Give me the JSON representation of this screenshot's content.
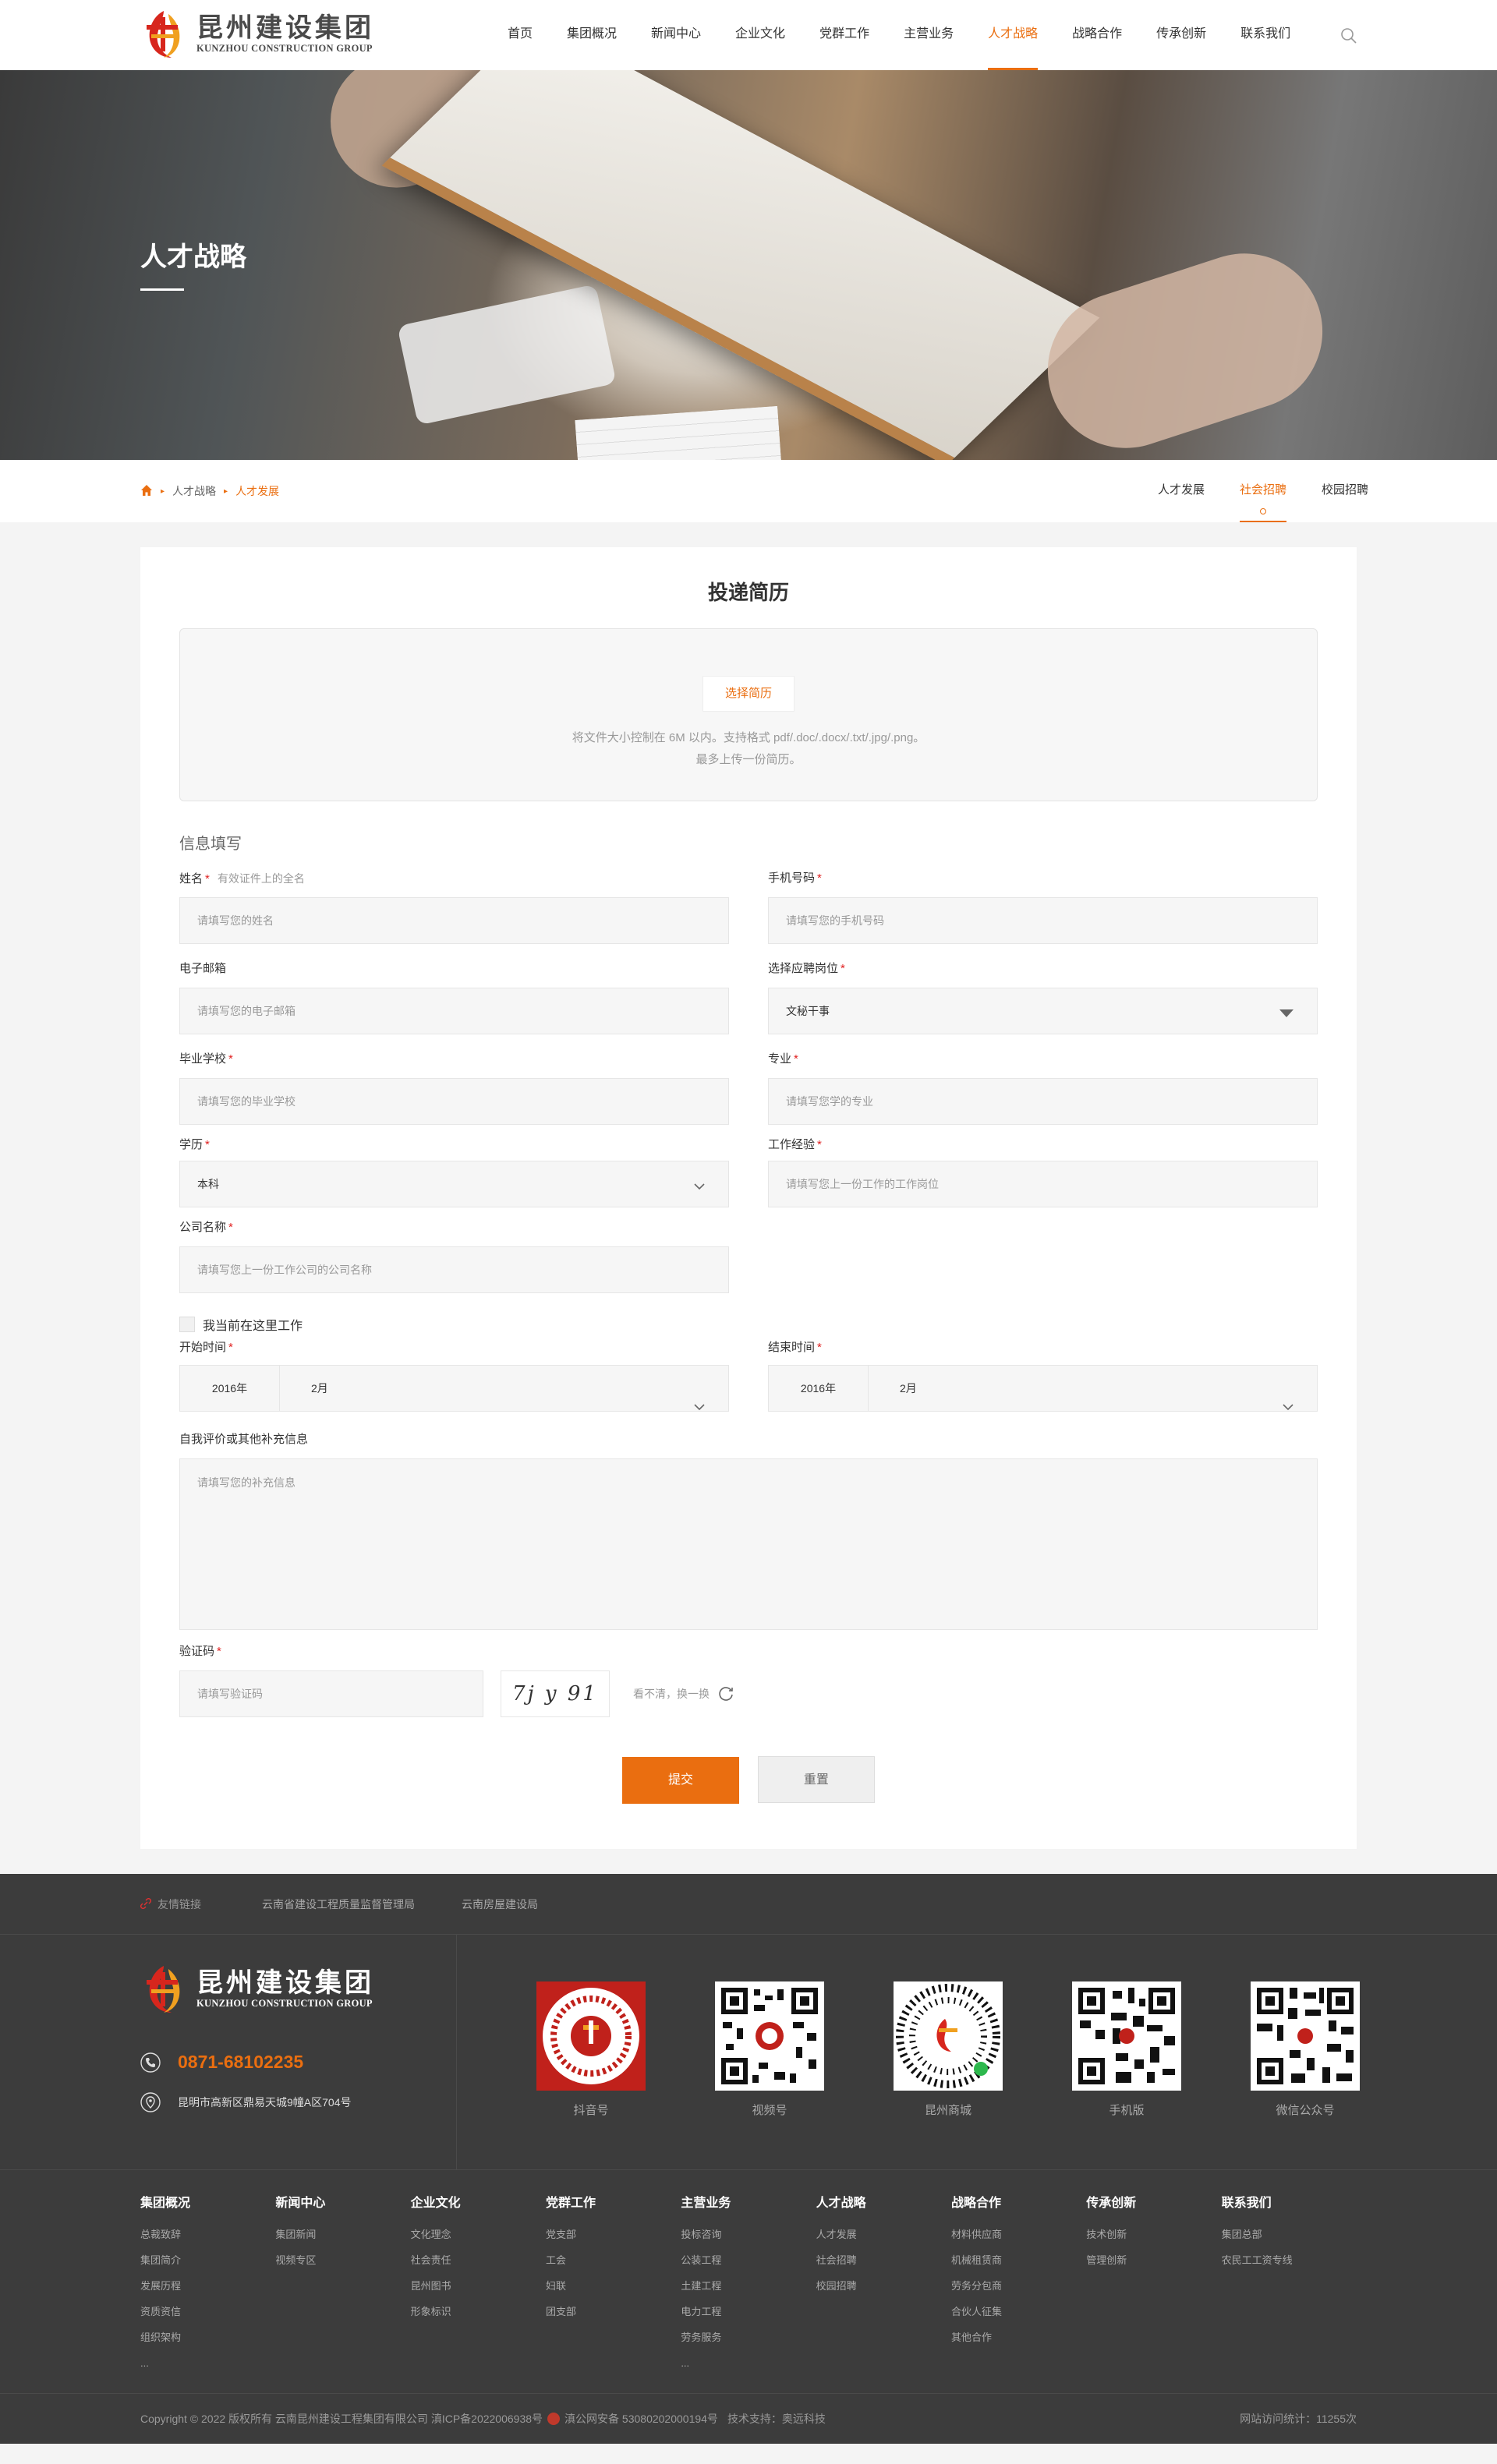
{
  "header": {
    "logo_cn": "昆州建设集团",
    "logo_en": "KUNZHOU CONSTRUCTION GROUP",
    "nav": [
      {
        "label": "首页"
      },
      {
        "label": "集团概况"
      },
      {
        "label": "新闻中心"
      },
      {
        "label": "企业文化"
      },
      {
        "label": "党群工作"
      },
      {
        "label": "主营业务"
      },
      {
        "label": "人才战略",
        "active": true
      },
      {
        "label": "战略合作"
      },
      {
        "label": "传承创新"
      },
      {
        "label": "联系我们"
      }
    ]
  },
  "banner": {
    "title": "人才战略"
  },
  "breadcrumb": {
    "items": [
      "人才战略",
      "人才发展"
    ]
  },
  "subtabs": [
    {
      "label": "人才发展"
    },
    {
      "label": "社会招聘",
      "active": true
    },
    {
      "label": "校园招聘"
    }
  ],
  "form": {
    "title": "投递简历",
    "upload": {
      "button": "选择简历",
      "tip1": "将文件大小控制在 6M 以内。支持格式 pdf/.doc/.docx/.txt/.jpg/.png。",
      "tip2": "最多上传一份简历。"
    },
    "section_title": "信息填写",
    "name": {
      "label": "姓名",
      "hint": "有效证件上的全名",
      "placeholder": "请填写您的姓名"
    },
    "phone": {
      "label": "手机号码",
      "placeholder": "请填写您的手机号码"
    },
    "email": {
      "label": "电子邮箱",
      "placeholder": "请填写您的电子邮箱"
    },
    "position": {
      "label": "选择应聘岗位",
      "value": "文秘干事"
    },
    "school": {
      "label": "毕业学校",
      "placeholder": "请填写您的毕业学校"
    },
    "major": {
      "label": "专业",
      "placeholder": "请填写您学的专业"
    },
    "education": {
      "label": "学历",
      "value": "本科"
    },
    "experience": {
      "label": "工作经验",
      "placeholder": "请填写您上一份工作的工作岗位"
    },
    "company": {
      "label": "公司名称",
      "placeholder": "请填写您上一份工作公司的公司名称"
    },
    "current_job": "我当前在这里工作",
    "start": {
      "label": "开始时间",
      "year": "2016年",
      "month": "2月"
    },
    "end": {
      "label": "结束时间",
      "year": "2016年",
      "month": "2月"
    },
    "comment": {
      "label": "自我评价或其他补充信息",
      "placeholder": "请填写您的补充信息"
    },
    "captcha": {
      "label": "验证码",
      "placeholder": "请填写验证码",
      "image_text": "7j y 91",
      "refresh": "看不清，换一换"
    },
    "required_mark": "*",
    "submit": "提交",
    "reset": "重置"
  },
  "footer": {
    "links_label": "友情链接",
    "links": [
      "云南省建设工程质量监督管理局",
      "云南房屋建设局"
    ],
    "logo_cn": "昆州建设集团",
    "logo_en": "KUNZHOU CONSTRUCTION GROUP",
    "phone": "0871-68102235",
    "address": "昆明市高新区鼎易天城9幢A区704号",
    "qrcodes": [
      "抖音号",
      "视频号",
      "昆州商城",
      "手机版",
      "微信公众号"
    ],
    "columns": [
      {
        "title": "集团概况",
        "items": [
          "总裁致辞",
          "集团简介",
          "发展历程",
          "资质资信",
          "组织架构",
          "..."
        ]
      },
      {
        "title": "新闻中心",
        "items": [
          "集团新闻",
          "视频专区"
        ]
      },
      {
        "title": "企业文化",
        "items": [
          "文化理念",
          "社会责任",
          "昆州图书",
          "形象标识"
        ]
      },
      {
        "title": "党群工作",
        "items": [
          "党支部",
          "工会",
          "妇联",
          "团支部"
        ]
      },
      {
        "title": "主营业务",
        "items": [
          "投标咨询",
          "公装工程",
          "土建工程",
          "电力工程",
          "劳务服务",
          "..."
        ]
      },
      {
        "title": "人才战略",
        "items": [
          "人才发展",
          "社会招聘",
          "校园招聘"
        ]
      },
      {
        "title": "战略合作",
        "items": [
          "材料供应商",
          "机械租赁商",
          "劳务分包商",
          "合伙人征集",
          "其他合作"
        ]
      },
      {
        "title": "传承创新",
        "items": [
          "技术创新",
          "管理创新"
        ]
      },
      {
        "title": "联系我们",
        "items": [
          "集团总部",
          "农民工工资专线"
        ]
      }
    ],
    "copyright": "Copyright © 2022 版权所有 云南昆州建设工程集团有限公司 滇ICP备2022006938号",
    "police": "滇公网安备 53080202000194号",
    "tech": "技术支持：奥远科技",
    "visits": "网站访问统计：11255次"
  },
  "colors": {
    "accent": "#ea6e10",
    "footer_bg": "#3c3c3c"
  }
}
